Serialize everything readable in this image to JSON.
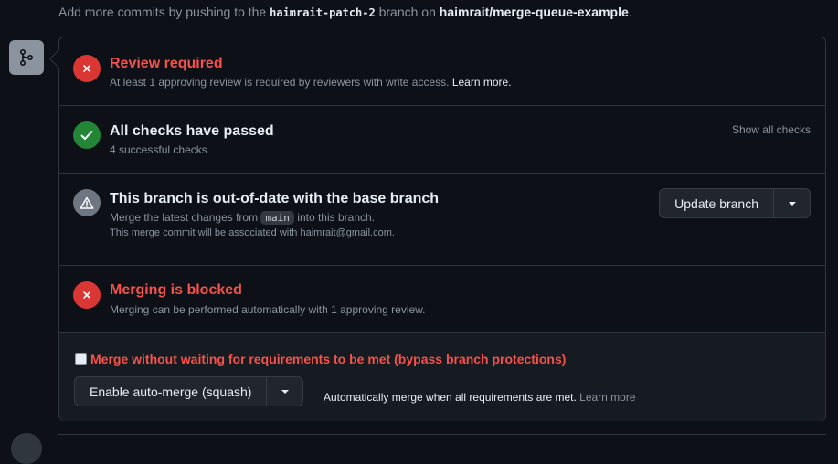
{
  "header": {
    "prefix": "Add more commits by pushing to the",
    "branch": "haimrait-patch-2",
    "middle": "branch on",
    "repo": "haimrait/merge-queue-example",
    "suffix": "."
  },
  "review": {
    "title": "Review required",
    "description": "At least 1 approving review is required by reviewers with write access.",
    "learn_more": "Learn more."
  },
  "checks": {
    "title": "All checks have passed",
    "description": "4 successful checks",
    "show_all": "Show all checks"
  },
  "outdated": {
    "title": "This branch is out-of-date with the base branch",
    "desc_prefix": "Merge the latest changes from",
    "base_branch": "main",
    "desc_suffix": "into this branch.",
    "commit_note": "This merge commit will be associated with haimrait@gmail.com.",
    "update_button": "Update branch"
  },
  "blocked": {
    "title": "Merging is blocked",
    "description": "Merging can be performed automatically with 1 approving review."
  },
  "merge_actions": {
    "bypass_label": "Merge without waiting for requirements to be met (bypass branch protections)",
    "bypass_checked": false,
    "auto_merge_button": "Enable auto-merge (squash)",
    "auto_merge_note": "Automatically merge when all requirements are met.",
    "learn_more": "Learn more"
  },
  "icons": {
    "merge": "git-merge-icon",
    "review": "x-circle-icon",
    "checks": "check-circle-icon",
    "outdated": "alert-icon",
    "blocked": "x-circle-icon"
  },
  "colors": {
    "danger": "#f85149",
    "success": "#238636",
    "muted": "#8b949e"
  }
}
